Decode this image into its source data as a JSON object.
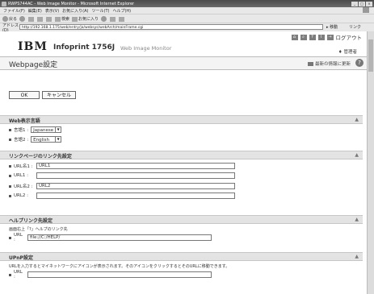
{
  "browser": {
    "title": "RWPS744AC - Web Image Monitor - Microsoft Internet Explorer",
    "menu": [
      "ファイル(F)",
      "編集(E)",
      "表示(V)",
      "お気に入り(A)",
      "ツール(T)",
      "ヘルプ(H)"
    ],
    "toolbar": {
      "back": "戻る",
      "search": "検索",
      "favorites": "お気に入り"
    },
    "address_label": "アドレス(D)",
    "address_value": "http://192.168.1.175/web/entry/ja/websys/webArch/mainFrame.cgi",
    "go_label": "移動",
    "links_label": "リンク"
  },
  "header": {
    "logout_label": "ログアウト",
    "logo": "IBM",
    "product_name": "Infoprint 1756J",
    "product_sub": "Web Image Monitor",
    "user_label": "管理者"
  },
  "page_title": "Webpage設定",
  "print_link": "最新の情報に更新",
  "buttons": {
    "ok": "OK",
    "cancel": "キャンセル"
  },
  "sections": {
    "display_language": {
      "title": "Web表示言語",
      "rows": [
        {
          "label": "言語1 :",
          "value": "Japanese"
        },
        {
          "label": "言語2 :",
          "value": "English"
        }
      ]
    },
    "link_page": {
      "title": "リンクページのリンク先設定",
      "rows": [
        {
          "label": "URL名1 :",
          "value": "URL1"
        },
        {
          "label": "URL1 :",
          "value": ""
        },
        {
          "label": "URL名2 :",
          "value": "URL2"
        },
        {
          "label": "URL2 :",
          "value": ""
        }
      ]
    },
    "help_link": {
      "title": "ヘルプリンク先設定",
      "desc": "画面右上「?」ヘルプのリンク先",
      "rows": [
        {
          "label": "URL :",
          "value": "file://C:/HELP/"
        }
      ]
    },
    "upnp": {
      "title": "UPnP設定",
      "desc": "URLを入力するとマイネットワークにアイコンが表示されます。そのアイコンをクリックするとそのURLに移動できます。",
      "rows": [
        {
          "label": "URL :",
          "value": ""
        }
      ]
    }
  }
}
